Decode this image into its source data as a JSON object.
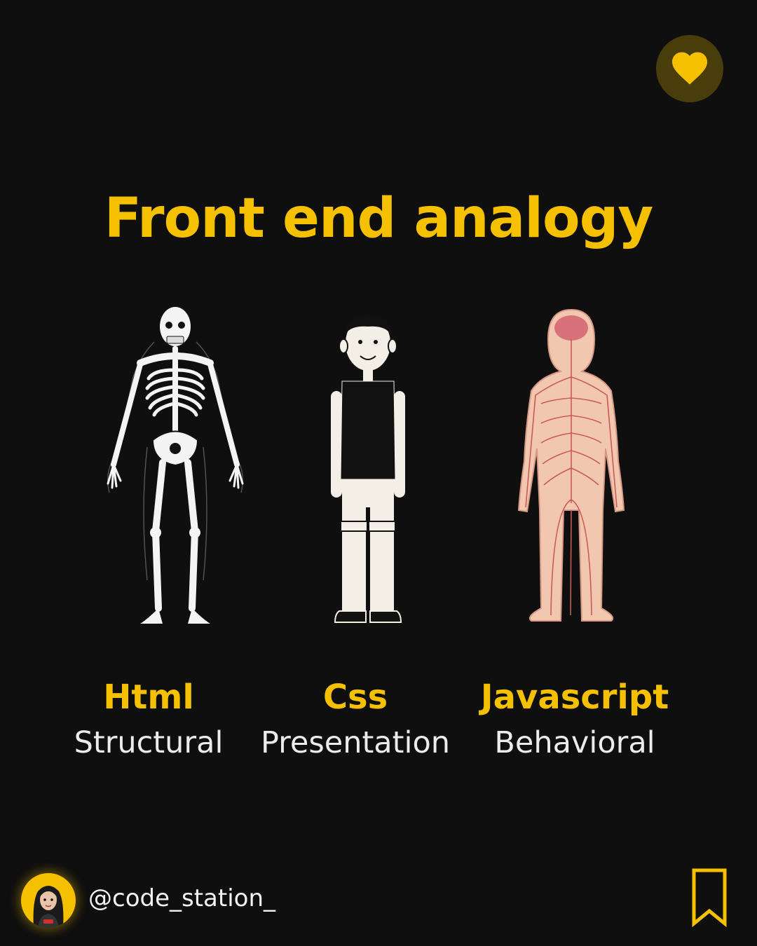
{
  "title": "Front end analogy",
  "accent_color": "#f5c000",
  "background_color": "#0f0f0f",
  "actions": {
    "like_icon": "heart-icon",
    "save_icon": "bookmark-icon"
  },
  "columns": [
    {
      "name": "Html",
      "role": "Structural",
      "illustration": "skeleton"
    },
    {
      "name": "Css",
      "role": "Presentation",
      "illustration": "cartoon-person"
    },
    {
      "name": "Javascript",
      "role": "Behavioral",
      "illustration": "nervous-system-body"
    }
  ],
  "footer": {
    "handle": "@code_station_",
    "avatar_icon": "avatar"
  }
}
